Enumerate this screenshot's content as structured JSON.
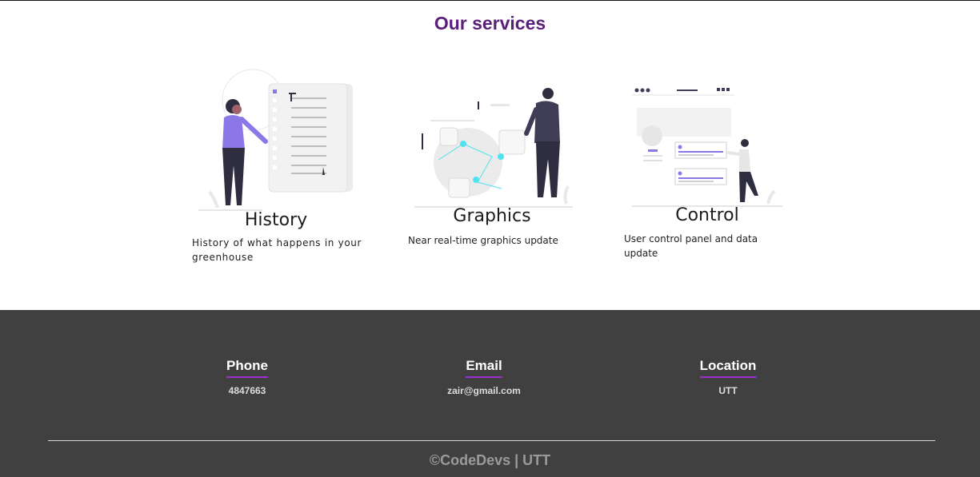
{
  "services": {
    "title": "Our services",
    "items": [
      {
        "name": "History",
        "description": "History of what happens in your greenhouse",
        "illustration": "person-with-document-illustration"
      },
      {
        "name": "Graphics",
        "description": "Near real-time graphics update",
        "illustration": "person-with-charts-illustration"
      },
      {
        "name": "Control",
        "description": "User control panel and data update",
        "illustration": "person-with-control-panel-illustration"
      }
    ]
  },
  "footer": {
    "contacts": [
      {
        "title": "Phone",
        "value": "4847663"
      },
      {
        "title": "Email",
        "value": "zair@gmail.com"
      },
      {
        "title": "Location",
        "value": "UTT"
      }
    ],
    "copyright": "©CodeDevs | UTT"
  },
  "colors": {
    "title_purple": "#5a1f78",
    "accent_purple": "#9b2fd0",
    "footer_bg": "#404040",
    "illustration_purple": "#8b78e6",
    "illustration_cyan": "#4fe3f0",
    "illustration_dark": "#2f2e41"
  }
}
